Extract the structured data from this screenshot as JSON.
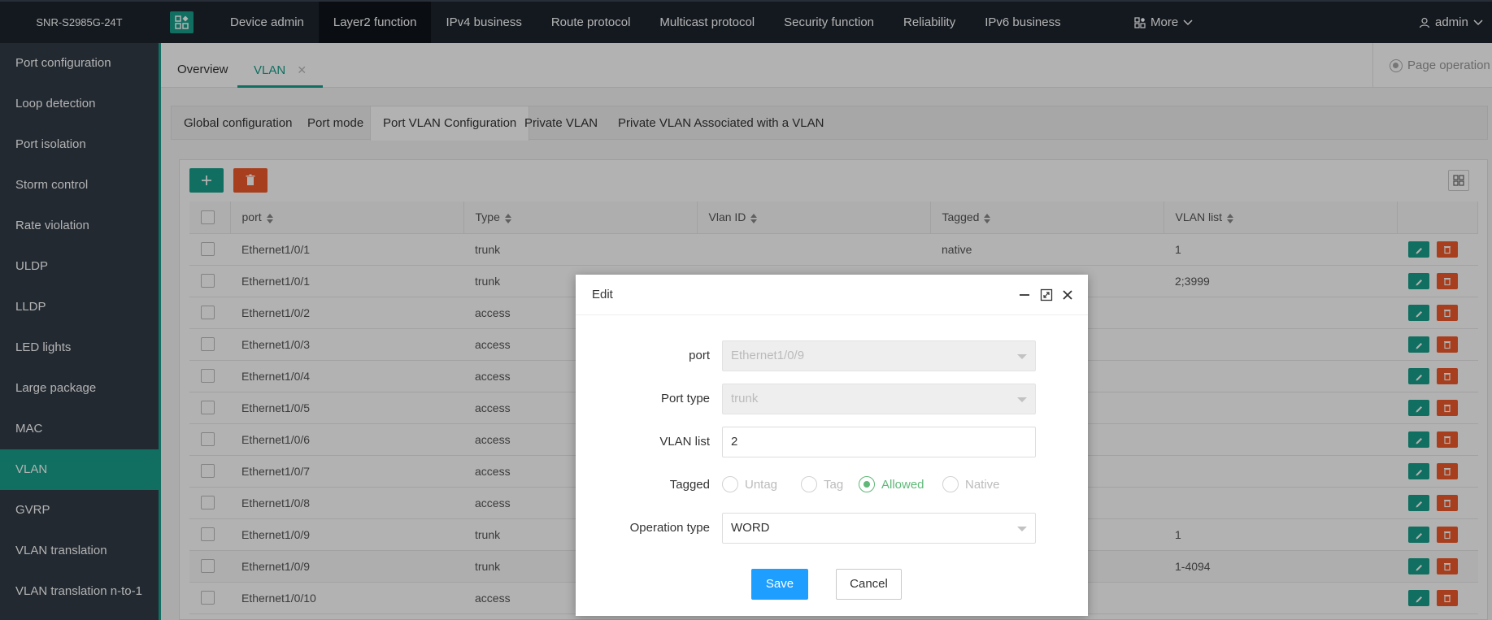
{
  "brand": "SNR-S2985G-24T",
  "nav": [
    "Device admin",
    "Layer2 function",
    "IPv4 business",
    "Route protocol",
    "Multicast protocol",
    "Security function",
    "Reliability",
    "IPv6 business"
  ],
  "nav_active_index": 1,
  "more_label": "More",
  "user_label": "admin",
  "sidebar": [
    "Port configuration",
    "Loop detection",
    "Port isolation",
    "Storm control",
    "Rate violation",
    "ULDP",
    "LLDP",
    "LED lights",
    "Large package",
    "MAC",
    "VLAN",
    "GVRP",
    "VLAN translation",
    "VLAN translation n-to-1"
  ],
  "sidebar_active_index": 10,
  "tabs": {
    "overview": "Overview",
    "vlan": "VLAN",
    "page_operation": "Page operation"
  },
  "subtabs": [
    "Global configuration",
    "Port mode",
    "Port VLAN Configuration",
    "Private VLAN",
    "Private VLAN Associated with a VLAN"
  ],
  "subtab_active_index": 2,
  "table": {
    "headers": [
      "port",
      "Type",
      "Vlan ID",
      "Tagged",
      "VLAN list"
    ],
    "rows": [
      [
        "Ethernet1/0/1",
        "trunk",
        "",
        "native",
        "1"
      ],
      [
        "Ethernet1/0/1",
        "trunk",
        "",
        "",
        "2;3999"
      ],
      [
        "Ethernet1/0/2",
        "access",
        "",
        "",
        ""
      ],
      [
        "Ethernet1/0/3",
        "access",
        "",
        "",
        ""
      ],
      [
        "Ethernet1/0/4",
        "access",
        "",
        "",
        ""
      ],
      [
        "Ethernet1/0/5",
        "access",
        "",
        "",
        ""
      ],
      [
        "Ethernet1/0/6",
        "access",
        "",
        "",
        ""
      ],
      [
        "Ethernet1/0/7",
        "access",
        "",
        "",
        ""
      ],
      [
        "Ethernet1/0/8",
        "access",
        "",
        "",
        ""
      ],
      [
        "Ethernet1/0/9",
        "trunk",
        "",
        "",
        "1"
      ],
      [
        "Ethernet1/0/9",
        "trunk",
        "",
        "",
        "1-4094"
      ],
      [
        "Ethernet1/0/10",
        "access",
        "",
        "",
        ""
      ]
    ]
  },
  "dialog": {
    "title": "Edit",
    "port_label": "port",
    "port_value": "Ethernet1/0/9",
    "port_type_label": "Port type",
    "port_type_value": "trunk",
    "vlan_list_label": "VLAN list",
    "vlan_list_value": "2",
    "tagged_label": "Tagged",
    "tagged_options": [
      "Untag",
      "Tag",
      "Allowed",
      "Native"
    ],
    "tagged_selected": "Allowed",
    "operation_type_label": "Operation type",
    "operation_type_value": "WORD",
    "save": "Save",
    "cancel": "Cancel"
  },
  "colors": {
    "accent": "#17a08a",
    "danger": "#f0592a",
    "primary": "#1e9fff",
    "radio_on": "#5fb878"
  }
}
